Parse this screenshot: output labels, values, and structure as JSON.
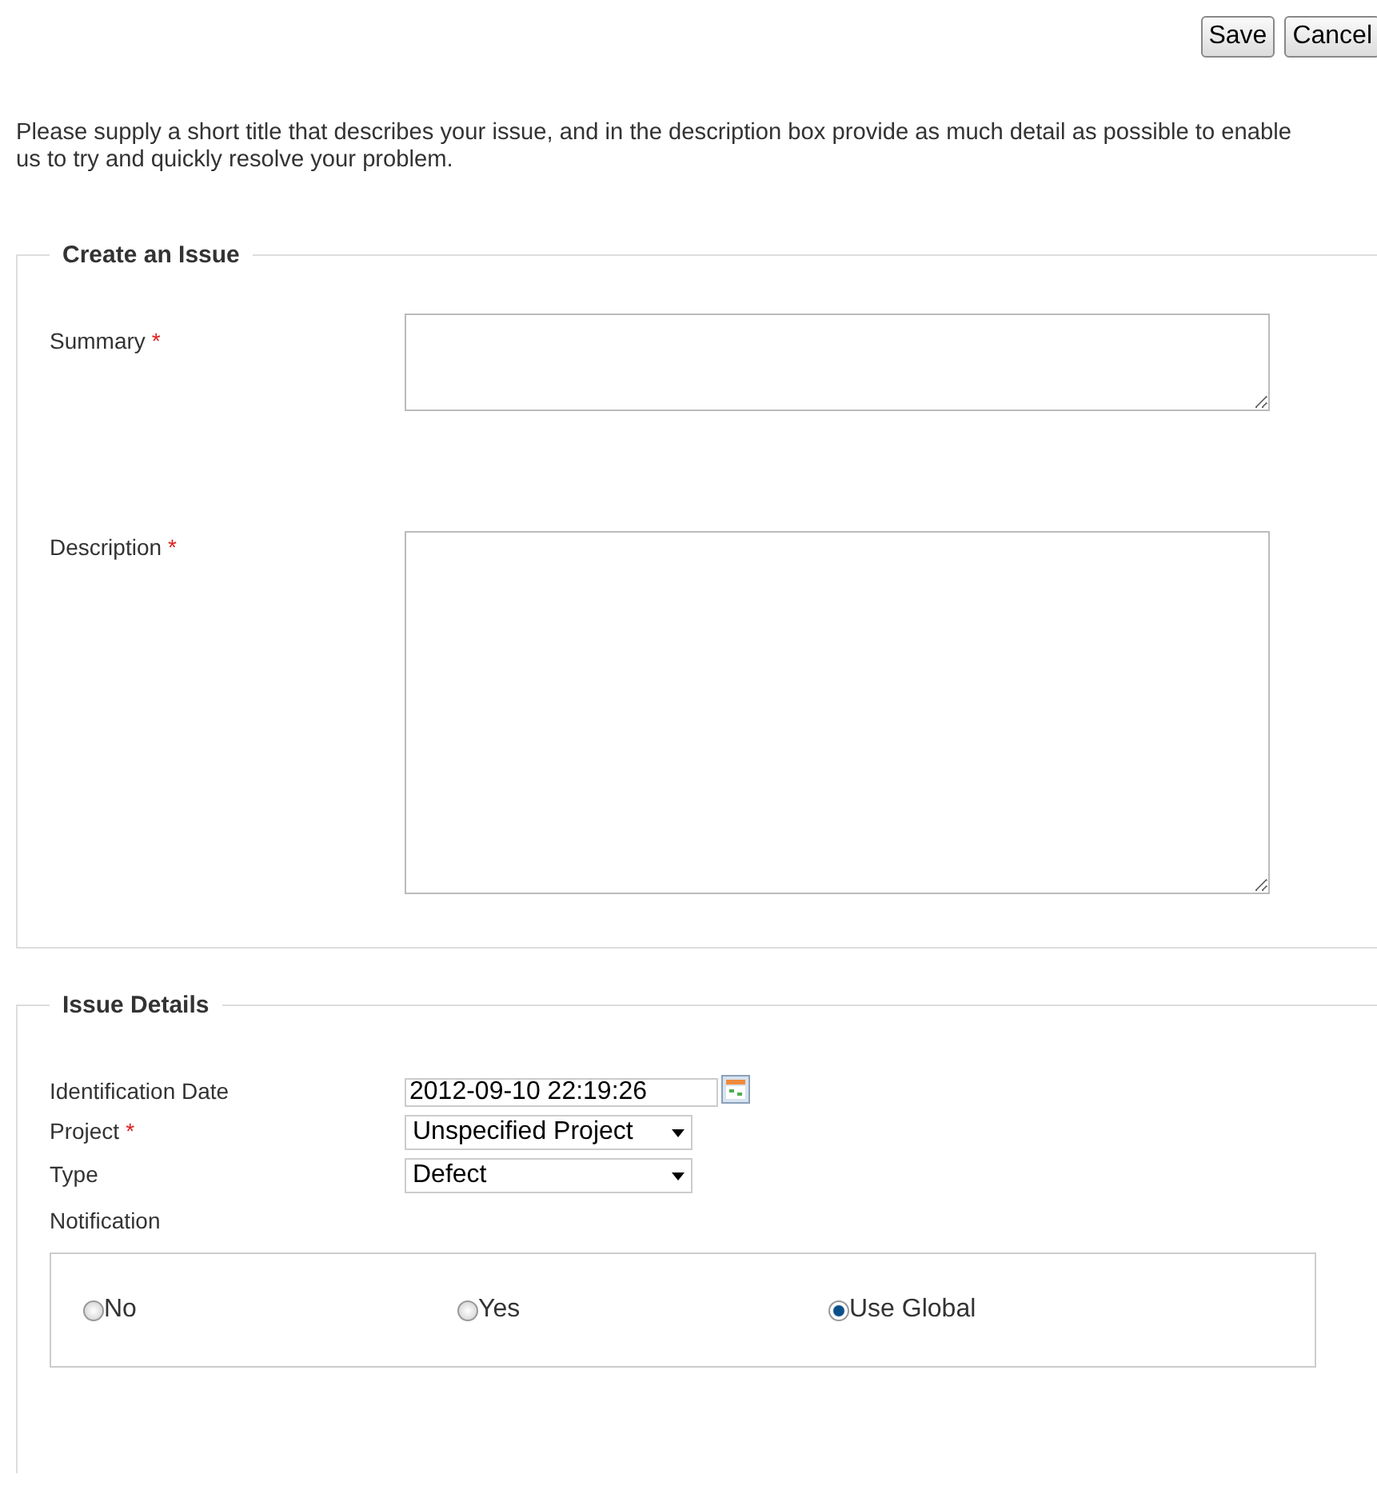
{
  "buttons": [
    {
      "label": "Save"
    },
    {
      "label": "Cancel"
    }
  ],
  "intro": "Please supply a short title that describes your issue, and in the description box provide as much detail as possible to enable us to try and quickly resolve your problem.",
  "create_issue": {
    "title": "Create an Issue",
    "fields": [
      {
        "label": "Summary",
        "required_mark": "*",
        "kind": "short"
      },
      {
        "label": "Description",
        "required_mark": "*",
        "kind": "long"
      }
    ]
  },
  "issue_details": {
    "title": "Issue Details",
    "fields": [
      {
        "label": "Identification Date",
        "kind": "date",
        "value": "2012-09-10 22:19:26"
      },
      {
        "label": "Project",
        "required_mark": "*",
        "kind": "select",
        "value": "Unspecified Project"
      },
      {
        "label": "Type",
        "kind": "select",
        "value": "Defect"
      },
      {
        "label": "Notification",
        "kind": "radios",
        "options": [
          {
            "label": "No",
            "selected": false
          },
          {
            "label": "Yes",
            "selected": false
          },
          {
            "label": "Use Global",
            "selected": true
          }
        ]
      }
    ]
  }
}
